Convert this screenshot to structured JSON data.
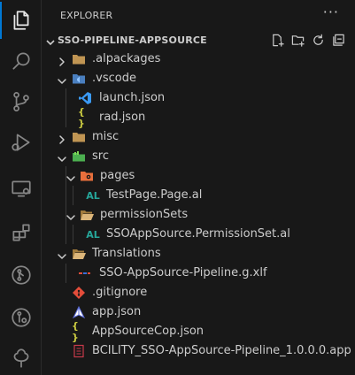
{
  "sidebar": {
    "title": "EXPLORER",
    "more_actions": "···",
    "section_title": "SSO-PIPELINE-APPSOURCE"
  },
  "activity_bar": [
    "explorer-icon",
    "search-icon",
    "source-control-icon",
    "run-debug-icon",
    "remote-explorer-icon",
    "extensions-icon",
    "git-graph-icon",
    "pull-requests-icon",
    "tree-icon"
  ],
  "tree": {
    "alpackages": ".alpackages",
    "vscode": ".vscode",
    "launch_json": "launch.json",
    "rad_json": "rad.json",
    "misc": "misc",
    "src": "src",
    "pages": "pages",
    "testpage": "TestPage.Page.al",
    "permissionsets": "permissionSets",
    "permissionset_file": "SSOAppSource.PermissionSet.al",
    "translations": "Translations",
    "xlf": "SSO-AppSource-Pipeline.g.xlf",
    "gitignore": ".gitignore",
    "app_json": "app.json",
    "appsourcecop": "AppSourceCop.json",
    "app_file": "BCILITY_SSO-AppSource-Pipeline_1.0.0.0.app"
  },
  "icon_text": {
    "al": "AL",
    "json_braces": "{ }"
  },
  "colors": {
    "folder": "#c09553",
    "al_icon": "#26a69a",
    "json_icon": "#cbcb41",
    "vscode_blue": "#3b9af5",
    "git_red": "#e44d3a",
    "accent": "#0078d4"
  }
}
